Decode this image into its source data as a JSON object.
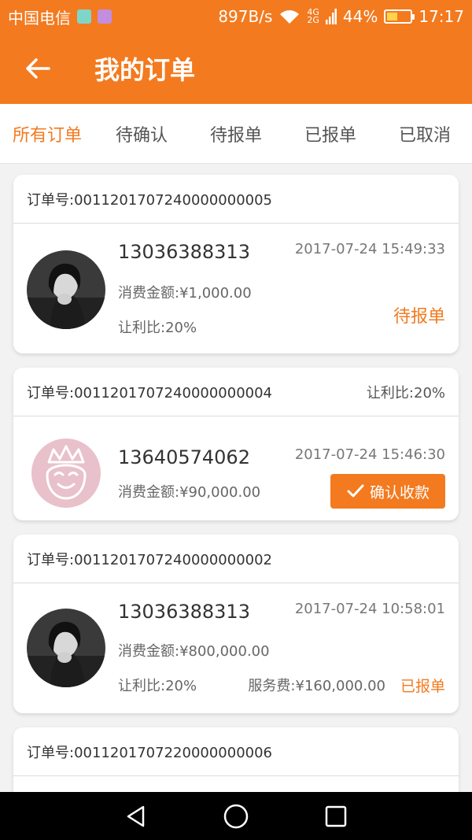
{
  "status_bar": {
    "carrier": "中国电信",
    "speed": "897B/s",
    "net_top": "4G",
    "net_bottom": "2G",
    "battery": "44%",
    "battery_level": 0.44,
    "time": "17:17"
  },
  "header": {
    "title": "我的订单",
    "back_icon": "arrow-left-icon"
  },
  "tabs": [
    {
      "label": "所有订单",
      "active": true
    },
    {
      "label": "待确认",
      "active": false
    },
    {
      "label": "待报单",
      "active": false
    },
    {
      "label": "已报单",
      "active": false
    },
    {
      "label": "已取消",
      "active": false
    }
  ],
  "orders": [
    {
      "order_no": "订单号:0011201707240000000005",
      "phone": "13036388313",
      "time": "2017-07-24 15:49:33",
      "amount": "消费金额:¥1,000.00",
      "ratio": "让利比:20%",
      "status": "待报单"
    },
    {
      "order_no": "订单号:0011201707240000000004",
      "ratio_right": "让利比:20%",
      "phone": "13640574062",
      "time": "2017-07-24 15:46:30",
      "amount": "消费金额:¥90,000.00",
      "confirm_label": "确认收款"
    },
    {
      "order_no": "订单号:0011201707240000000002",
      "phone": "13036388313",
      "time": "2017-07-24 10:58:01",
      "amount": "消费金额:¥800,000.00",
      "ratio": "让利比:20%",
      "fee": "服务费:¥160,000.00",
      "status": "已报单"
    },
    {
      "order_no": "订单号:0011201707220000000006"
    }
  ],
  "colors": {
    "accent": "#f37a1f",
    "nav_bg": "#000000"
  }
}
